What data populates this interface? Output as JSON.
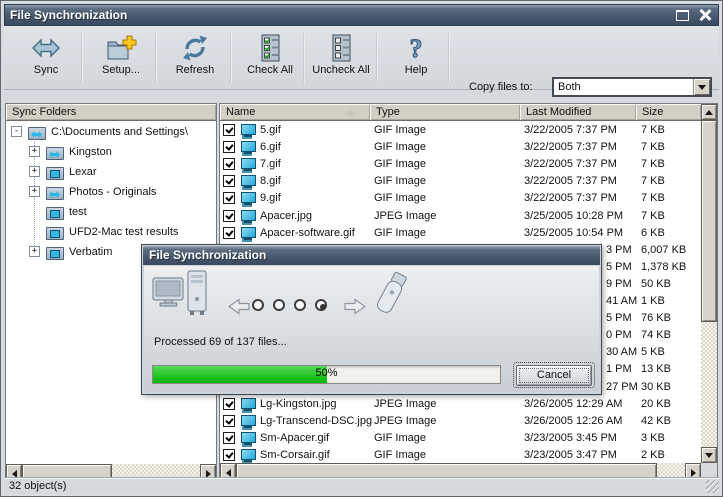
{
  "window": {
    "title": "File Synchronization"
  },
  "toolbar": {
    "buttons": [
      {
        "label": "Sync"
      },
      {
        "label": "Setup..."
      },
      {
        "label": "Refresh"
      },
      {
        "label": "Check All"
      },
      {
        "label": "Uncheck All"
      },
      {
        "label": "Help"
      }
    ],
    "copy_files_label": "Copy files to:",
    "copy_files_value": "Both"
  },
  "sidebar": {
    "header": "Sync Folders",
    "tree": [
      {
        "label": "C:\\Documents and Settings\\",
        "expander": "-",
        "icon": "sync-folder",
        "level": 0
      },
      {
        "label": "Kingston",
        "expander": "+",
        "icon": "sync-folder",
        "level": 1
      },
      {
        "label": "Lexar",
        "expander": "+",
        "icon": "device-folder",
        "level": 1
      },
      {
        "label": "Photos - Originals",
        "expander": "+",
        "icon": "sync-folder",
        "level": 1
      },
      {
        "label": "test",
        "expander": "",
        "icon": "device-folder",
        "level": 1
      },
      {
        "label": "UFD2-Mac test results",
        "expander": "",
        "icon": "device-folder",
        "level": 1
      },
      {
        "label": "Verbatim",
        "expander": "+",
        "icon": "device-folder",
        "level": 1
      }
    ]
  },
  "file_list": {
    "columns": [
      "Name",
      "Type",
      "Last Modified",
      "Size"
    ],
    "rows": [
      {
        "checked": true,
        "name": "5.gif",
        "type": "GIF Image",
        "modified": "3/22/2005 7:37 PM",
        "size": "7 KB"
      },
      {
        "checked": true,
        "name": "6.gif",
        "type": "GIF Image",
        "modified": "3/22/2005 7:37 PM",
        "size": "7 KB"
      },
      {
        "checked": true,
        "name": "7.gif",
        "type": "GIF Image",
        "modified": "3/22/2005 7:37 PM",
        "size": "7 KB"
      },
      {
        "checked": true,
        "name": "8.gif",
        "type": "GIF Image",
        "modified": "3/22/2005 7:37 PM",
        "size": "7 KB"
      },
      {
        "checked": true,
        "name": "9.gif",
        "type": "GIF Image",
        "modified": "3/22/2005 7:37 PM",
        "size": "7 KB"
      },
      {
        "checked": true,
        "name": "Apacer.jpg",
        "type": "JPEG Image",
        "modified": "3/25/2005 10:28 PM",
        "size": "7 KB"
      },
      {
        "checked": true,
        "name": "Apacer-software.gif",
        "type": "GIF Image",
        "modified": "3/25/2005 10:54 PM",
        "size": "6 KB"
      },
      {
        "partial": true,
        "name": "",
        "type": "",
        "modified": "3 PM",
        "size": "6,007 KB"
      },
      {
        "partial": true,
        "name": "",
        "type": "",
        "modified": "5 PM",
        "size": "1,378 KB"
      },
      {
        "partial": true,
        "name": "",
        "type": "",
        "modified": "9 PM",
        "size": "50 KB"
      },
      {
        "partial": true,
        "name": "",
        "type": "",
        "modified": "41 AM",
        "size": "1 KB"
      },
      {
        "partial": true,
        "name": "",
        "type": "",
        "modified": "5 PM",
        "size": "76 KB"
      },
      {
        "partial": true,
        "name": "",
        "type": "",
        "modified": "0 PM",
        "size": "74 KB"
      },
      {
        "partial": true,
        "name": "",
        "type": "",
        "modified": "30 AM",
        "size": "5 KB"
      },
      {
        "partial": true,
        "name": "",
        "type": "",
        "modified": "1 PM",
        "size": "13 KB"
      },
      {
        "partial": true,
        "name": "",
        "type": "",
        "modified": "27 PM",
        "size": "30 KB"
      },
      {
        "checked": true,
        "name": "Lg-Kingston.jpg",
        "type": "JPEG Image",
        "modified": "3/26/2005 12:29 AM",
        "size": "20 KB"
      },
      {
        "checked": true,
        "name": "Lg-Transcend-DSC.jpg",
        "type": "JPEG Image",
        "modified": "3/26/2005 12:26 AM",
        "size": "42 KB"
      },
      {
        "checked": true,
        "name": "Sm-Apacer.gif",
        "type": "GIF Image",
        "modified": "3/23/2005 3:45 PM",
        "size": "3 KB"
      },
      {
        "checked": true,
        "name": "Sm-Corsair.gif",
        "type": "GIF Image",
        "modified": "3/23/2005 3:47 PM",
        "size": "2 KB"
      }
    ]
  },
  "status_bar": {
    "text": "32 object(s)"
  },
  "dialog": {
    "title": "File Synchronization",
    "message": "Processed 69 of 137 files...",
    "progress_percent": 50,
    "progress_label": "50%",
    "cancel_label": "Cancel"
  },
  "colors": {
    "titlebar": "#46586d",
    "toolbar_bg": "#d6d9dd",
    "header_bg": "#d3cfc5",
    "progress_green": "#00b400",
    "monitor_cyan": "#35b9e9"
  }
}
